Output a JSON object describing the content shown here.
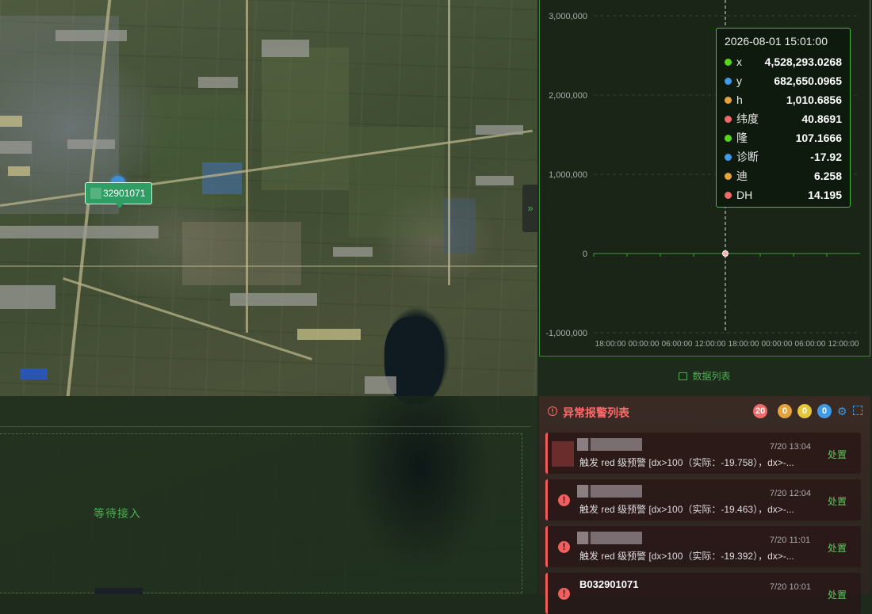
{
  "map": {
    "marker_label": "32901071",
    "waiting_text": "等待接入",
    "collapse_icon": "double-chevron-right-icon"
  },
  "chart": {
    "tooltip": {
      "time": "2026-08-01 15:01:00",
      "rows": [
        {
          "name": "x",
          "value": "4,528,293.0268",
          "color": "#52d81b"
        },
        {
          "name": "y",
          "value": "682,650.0965",
          "color": "#3d9be8"
        },
        {
          "name": "h",
          "value": "1,010.6856",
          "color": "#e3a33a"
        },
        {
          "name": "纬度",
          "value": "40.8691",
          "color": "#f06a6a"
        },
        {
          "name": "隆",
          "value": "107.1666",
          "color": "#52d81b"
        },
        {
          "name": "诊断",
          "value": "-17.92",
          "color": "#3d9be8"
        },
        {
          "name": "迪",
          "value": "6.258",
          "color": "#e3a33a"
        },
        {
          "name": "DH",
          "value": "14.195",
          "color": "#f06a6a"
        }
      ]
    },
    "data_list_label": "数据列表"
  },
  "chart_data": {
    "type": "line",
    "y_ticks": [
      "3,000,000",
      "2,000,000",
      "1,000,000",
      "0",
      "-1,000,000"
    ],
    "ylim": [
      -1000000,
      3000000
    ],
    "x_ticks": [
      "18:00:00",
      "00:00:00",
      "06:00:00",
      "12:00:00",
      "18:00:00",
      "00:00:00",
      "06:00:00",
      "12:00:00"
    ],
    "cursor_point": {
      "x_label": "2026-08-01 15:01:00",
      "y": 0
    },
    "grid": true
  },
  "alarm": {
    "title": "异常报警列表",
    "badges": [
      {
        "count": "20",
        "color": "#f06a6a"
      },
      {
        "count": "0",
        "color": "#e3a33a"
      },
      {
        "count": "0",
        "color": "#e3c63a"
      },
      {
        "count": "0",
        "color": "#3d9be8"
      }
    ],
    "items": [
      {
        "name": "",
        "time": "7/20 13:04",
        "msg": "触发 red 级预警 [dx>100（实际：-19.758），dx>-...",
        "action": "处置"
      },
      {
        "name": "",
        "time": "7/20 12:04",
        "msg": "触发 red 级预警 [dx>100（实际：-19.463），dx>-...",
        "action": "处置"
      },
      {
        "name": "",
        "time": "7/20 11:01",
        "msg": "触发 red 级预警 [dx>100（实际：-19.392），dx>-...",
        "action": "处置"
      },
      {
        "name": "B032901071",
        "time": "7/20 10:01",
        "msg": "",
        "action": "处置"
      }
    ]
  }
}
